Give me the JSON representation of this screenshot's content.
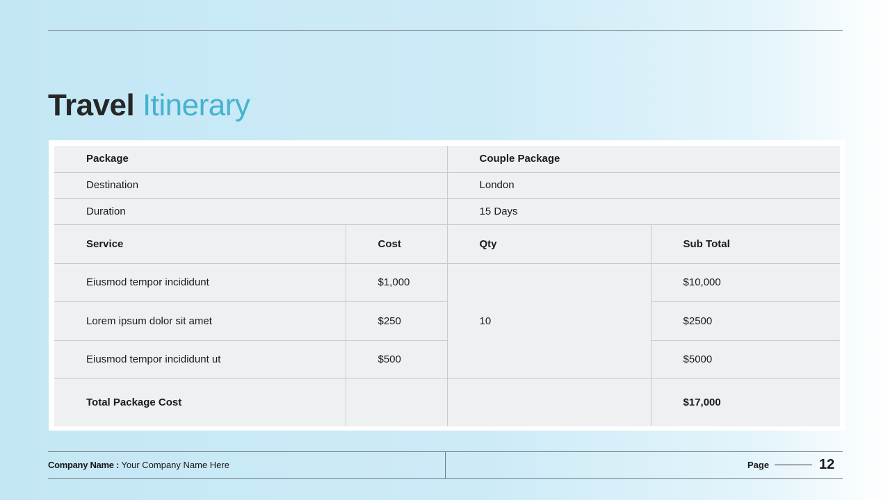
{
  "title": {
    "part1": "Travel",
    "part2": "Itinerary"
  },
  "table": {
    "package": {
      "label": "Package",
      "value": "Couple Package"
    },
    "destination": {
      "label": "Destination",
      "value": "London"
    },
    "duration": {
      "label": "Duration",
      "value": "15 Days"
    },
    "headers": {
      "service": "Service",
      "cost": "Cost",
      "qty": "Qty",
      "subtotal": "Sub Total"
    },
    "services": [
      {
        "service": "Eiusmod tempor incididunt",
        "cost": "$1,000",
        "subtotal": "$10,000"
      },
      {
        "service": "Lorem ipsum dolor sit amet",
        "cost": "$250",
        "subtotal": "$2500"
      },
      {
        "service": "Eiusmod tempor incididunt ut",
        "cost": "$500",
        "subtotal": "$5000"
      }
    ],
    "qty_value": "10",
    "total": {
      "label": "Total Package Cost",
      "value": "$17,000"
    }
  },
  "footer": {
    "company_label": "Company Name :",
    "company_value": "Your Company Name Here",
    "page_label": "Page",
    "page_number": "12"
  },
  "colors": {
    "title_dark": "#262626",
    "title_accent": "#46b2cf",
    "table_bg": "#eff0f2",
    "faint_text": "#8f9aa3"
  }
}
